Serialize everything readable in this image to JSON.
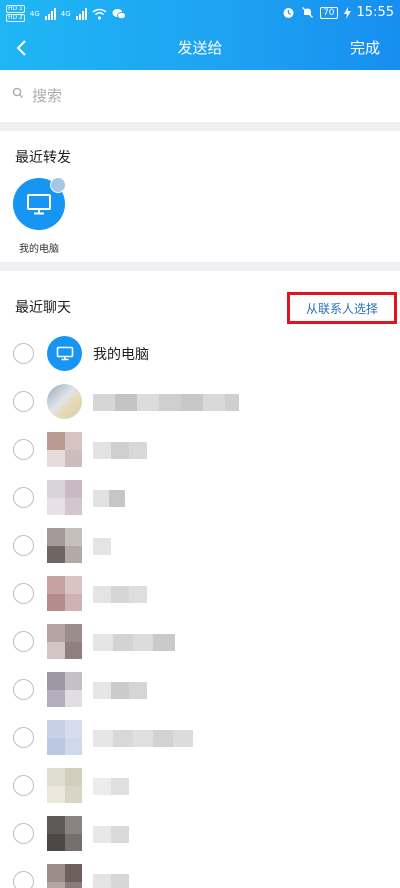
{
  "status_bar": {
    "sim1": "HD 1",
    "sim2": "HD 2",
    "network1": "4G",
    "network2": "4G",
    "battery": "70",
    "time": "15:55"
  },
  "header": {
    "title": "发送给",
    "done_label": "完成"
  },
  "search": {
    "placeholder": "搜索"
  },
  "recent_forward": {
    "title": "最近转发",
    "items": [
      {
        "label": "我的电脑",
        "icon": "computer-icon"
      }
    ]
  },
  "recent_chat": {
    "title": "最近聊天",
    "select_from_contacts": "从联系人选择",
    "items": [
      {
        "name": "我的电脑",
        "icon": "computer-icon"
      }
    ]
  },
  "colors": {
    "header_gradient": [
      "#1fb6f5",
      "#178ef0"
    ],
    "accent": "#1695f2",
    "highlight_box": "#e0141e",
    "link": "#2a6fc0"
  }
}
